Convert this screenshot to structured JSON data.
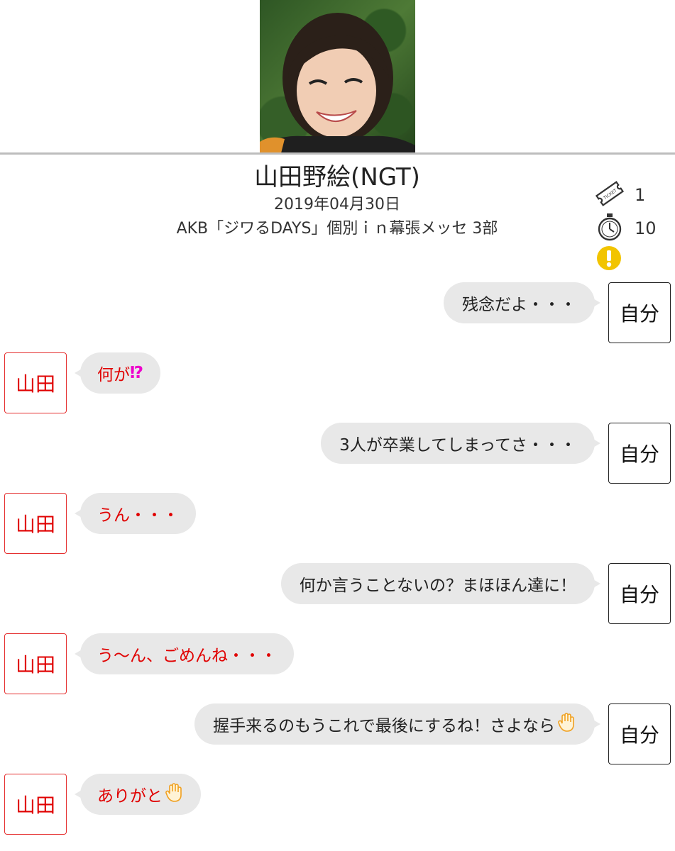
{
  "header": {
    "member_name": "山田野絵(NGT)",
    "event_date": "2019年04月30日",
    "event_name": "AKB「ジワるDAYS」個別ｉｎ幕張メッセ 3部"
  },
  "stats": {
    "ticket_icon": "ticket-icon",
    "ticket_count": "1",
    "timer_icon": "stopwatch-icon",
    "timer_seconds": "10",
    "warning_icon": "exclamation-icon"
  },
  "labels": {
    "self": "自分",
    "member": "山田"
  },
  "messages": [
    {
      "sender": "self",
      "text": "残念だよ・・・"
    },
    {
      "sender": "member",
      "text": "何が",
      "emoji": "⁉"
    },
    {
      "sender": "self",
      "text": "3人が卒業してしまってさ・・・"
    },
    {
      "sender": "member",
      "text": "うん・・・"
    },
    {
      "sender": "self",
      "text": "何か言うことないの？まほほん達に！"
    },
    {
      "sender": "member",
      "text": "う〜ん、ごめんね・・・"
    },
    {
      "sender": "self",
      "text": "握手来るのもうこれで最後にするね！さよなら",
      "emoji": "raised-hand-icon"
    },
    {
      "sender": "member",
      "text": "ありがと",
      "emoji": "raised-hand-icon"
    }
  ],
  "colors": {
    "member_text": "#e00000",
    "member_border": "#e53030",
    "bubble_bg": "#e8e8e8",
    "warning": "#f2c400",
    "emoji_magenta": "#ee00cc"
  }
}
